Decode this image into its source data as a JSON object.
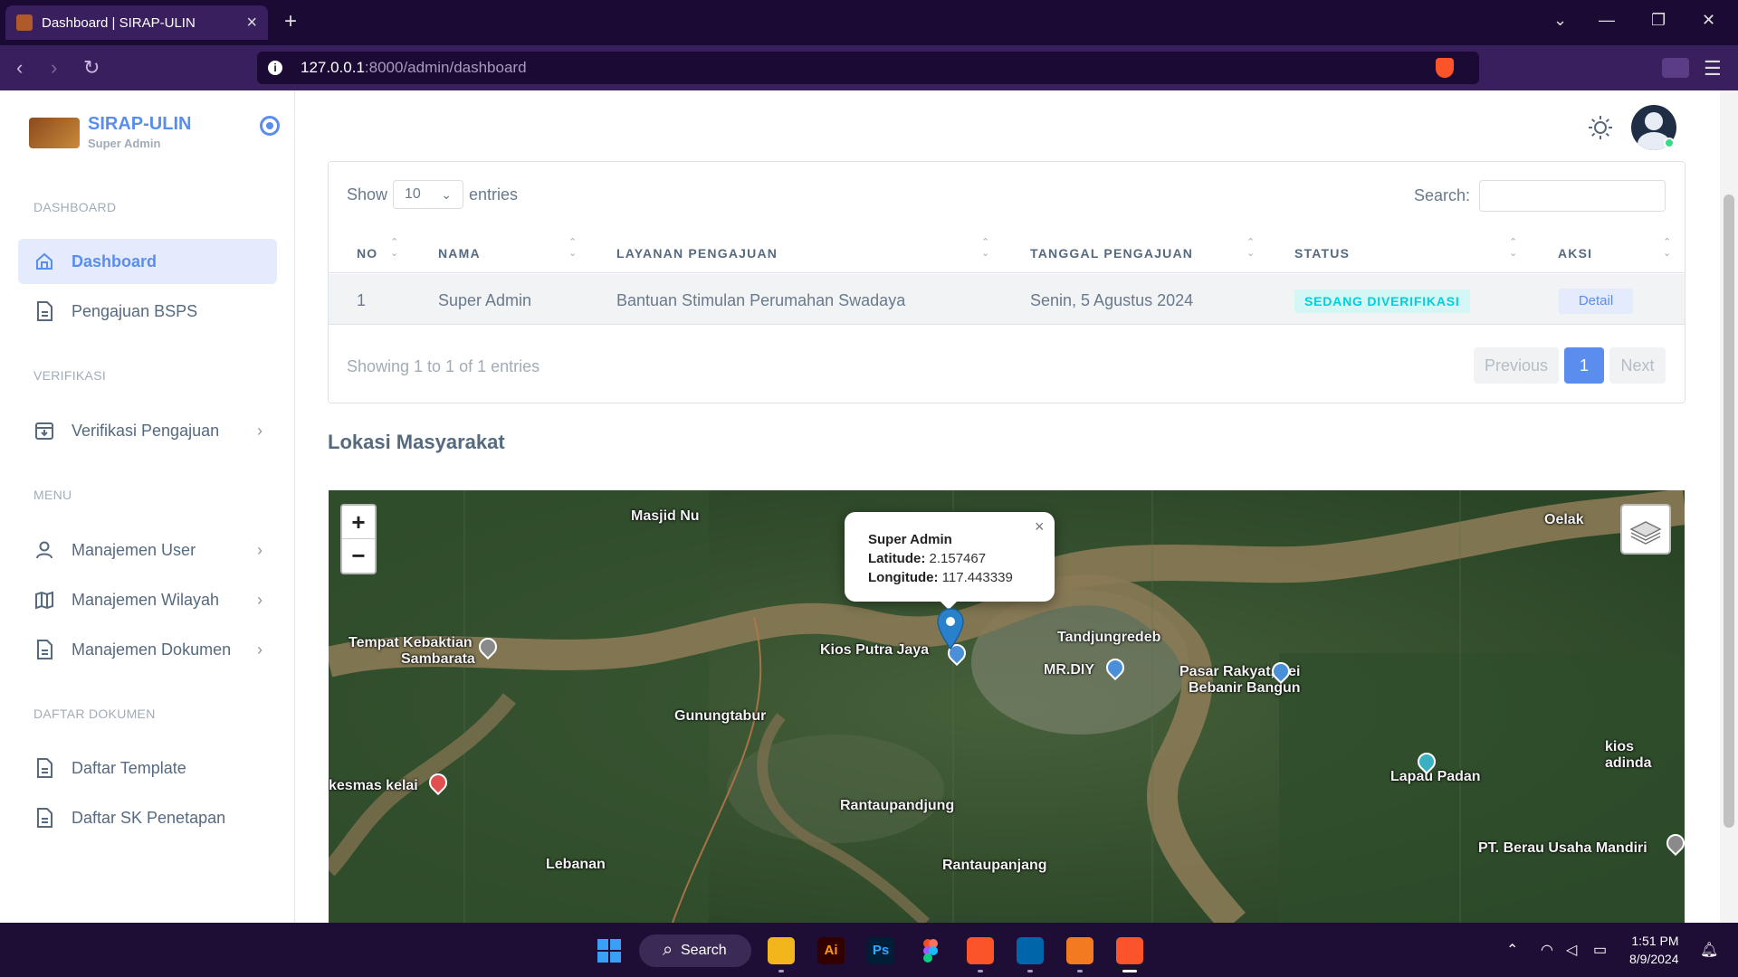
{
  "browser": {
    "tab_title": "Dashboard | SIRAP-ULIN",
    "url_host": "127.0.0.1",
    "url_path": ":8000/admin/dashboard"
  },
  "sidebar": {
    "brand": "SIRAP-ULIN",
    "role": "Super Admin",
    "sections": {
      "dashboard": "DASHBOARD",
      "verifikasi": "VERIFIKASI",
      "menu": "MENU",
      "daftar_dokumen": "DAFTAR DOKUMEN"
    },
    "items": {
      "dashboard": "Dashboard",
      "pengajuan_bsps": "Pengajuan BSPS",
      "verifikasi_pengajuan": "Verifikasi Pengajuan",
      "manajemen_user": "Manajemen User",
      "manajemen_wilayah": "Manajemen Wilayah",
      "manajemen_dokumen": "Manajemen Dokumen",
      "daftar_template": "Daftar Template",
      "daftar_sk_penetapan": "Daftar SK Penetapan"
    }
  },
  "table": {
    "show_label": "Show",
    "page_size": "10",
    "entries_label": "entries",
    "search_label": "Search:",
    "search_value": "",
    "columns": {
      "no": "NO",
      "nama": "NAMA",
      "layanan": "LAYANAN PENGAJUAN",
      "tanggal": "TANGGAL PENGAJUAN",
      "status": "STATUS",
      "aksi": "AKSI"
    },
    "rows": [
      {
        "no": "1",
        "nama": "Super Admin",
        "layanan": "Bantuan Stimulan Perumahan Swadaya",
        "tanggal": "Senin, 5 Agustus 2024",
        "status": "SEDANG DIVERIFIKASI",
        "aksi": "Detail"
      }
    ],
    "info": "Showing 1 to 1 of 1 entries",
    "pagination": {
      "previous": "Previous",
      "current": "1",
      "next": "Next"
    }
  },
  "map": {
    "title": "Lokasi Masyarakat",
    "zoom_in": "+",
    "zoom_out": "−",
    "popup": {
      "name": "Super Admin",
      "lat_label": "Latitude:",
      "lat": "2.157467",
      "lon_label": "Longitude:",
      "lon": "117.443339",
      "close": "×"
    },
    "labels": {
      "masjid": "Masjid Nu",
      "oelak": "Oelak",
      "tempat": "Tempat Kebaktian",
      "sambarata": "Sambarata",
      "kios": "Kios Putra Jaya",
      "tandjung": "Tandjungredeb",
      "mrdiy": "MR.DIY",
      "pasar1": "Pasar Rakyat, Sei",
      "pasar2": "Bebanir Bangun",
      "gunung": "Gunungtabur",
      "kiosadinda": "kios adinda",
      "lapau": "Lapau Padan",
      "kesmas": "kesmas kelai",
      "rantaupandjung": "Rantaupandjung",
      "ptberau": "PT. Berau Usaha Mandiri",
      "lebanan": "Lebanan",
      "rantaupanjang": "Rantaupanjang"
    }
  },
  "taskbar": {
    "search": "Search",
    "time": "1:51 PM",
    "date": "8/9/2024",
    "apps": {
      "ai": "Ai",
      "ps": "Ps"
    }
  },
  "colors": {
    "primary": "#5a8dee",
    "status_info": "#00cfdd",
    "online": "#39da8a",
    "browser_dark": "#1b0a33"
  }
}
